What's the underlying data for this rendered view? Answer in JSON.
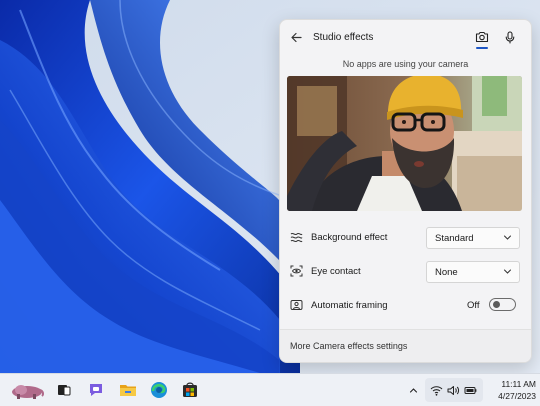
{
  "panel": {
    "title": "Studio effects",
    "status": "No apps are using your camera",
    "tabs": [
      {
        "name": "camera",
        "active": true
      },
      {
        "name": "microphone",
        "active": false
      }
    ],
    "settings": [
      {
        "label": "Background effect",
        "control": "dropdown",
        "value": "Standard",
        "icon": "background-effect-icon"
      },
      {
        "label": "Eye contact",
        "control": "dropdown",
        "value": "None",
        "icon": "eye-contact-icon"
      },
      {
        "label": "Automatic framing",
        "control": "toggle",
        "value": "Off",
        "icon": "framing-icon"
      }
    ],
    "footer_link": "More Camera effects settings"
  },
  "taskbar": {
    "apps": [
      "widgets-icon",
      "task-view-icon",
      "chat-icon",
      "file-explorer-icon",
      "edge-icon",
      "store-icon"
    ],
    "tray": [
      "chevron-up-icon",
      "wifi-icon",
      "volume-icon",
      "battery-icon"
    ],
    "time": "11:11 AM",
    "date": "4/27/2023"
  },
  "colors": {
    "accent": "#1d55c4",
    "wallpaper_blue": "#1f4fd8",
    "panel_bg": "#f3f3f5"
  }
}
